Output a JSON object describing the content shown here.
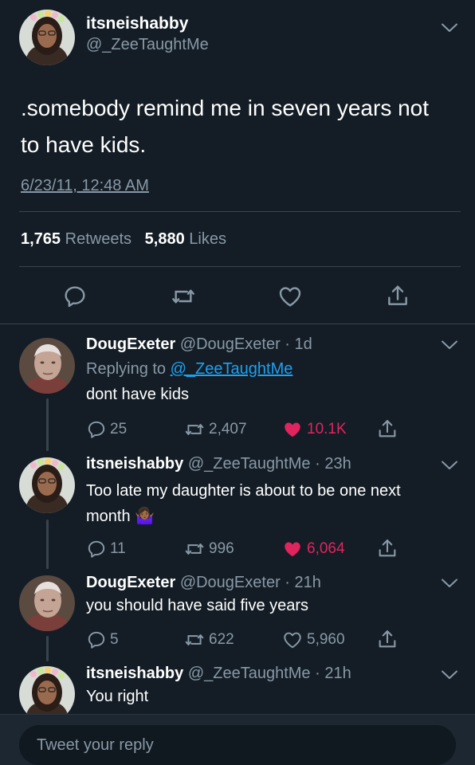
{
  "main_tweet": {
    "display_name": "itsneishabby",
    "handle": "@_ZeeTaughtMe",
    "text_line1": ".somebody remind me in seven years not",
    "text_line2": "to have kids.",
    "timestamp": "6/23/11, 12:48 AM",
    "retweets_count": "1,765",
    "retweets_label": "Retweets",
    "likes_count": "5,880",
    "likes_label": "Likes"
  },
  "replies": [
    {
      "display_name": "DougExeter",
      "handle": "@DougExeter",
      "time": "· 1d",
      "replying_to_label": "Replying to",
      "replying_to_handle": "@_ZeeTaughtMe",
      "text": "dont have kids",
      "reply_count": "25",
      "retweet_count": "2,407",
      "like_count": "10.1K",
      "liked": true
    },
    {
      "display_name": "itsneishabby",
      "handle": "@_ZeeTaughtMe",
      "time": "· 23h",
      "text_line1": "Too late my daughter is about to be one next",
      "text_line2": "month",
      "emoji": "🤷🏾‍♀️",
      "reply_count": "11",
      "retweet_count": "996",
      "like_count": "6,064",
      "liked": true
    },
    {
      "display_name": "DougExeter",
      "handle": "@DougExeter",
      "time": "· 21h",
      "text": "you should have said five years",
      "reply_count": "5",
      "retweet_count": "622",
      "like_count": "5,960",
      "liked": false
    },
    {
      "display_name": "itsneishabby",
      "handle": "@_ZeeTaughtMe",
      "time": "· 21h",
      "text": "You right"
    }
  ],
  "composer": {
    "placeholder": "Tweet your reply"
  },
  "colors": {
    "background": "#141d26",
    "muted": "#8899a6",
    "link": "#1da1f2",
    "like": "#e0245e"
  }
}
